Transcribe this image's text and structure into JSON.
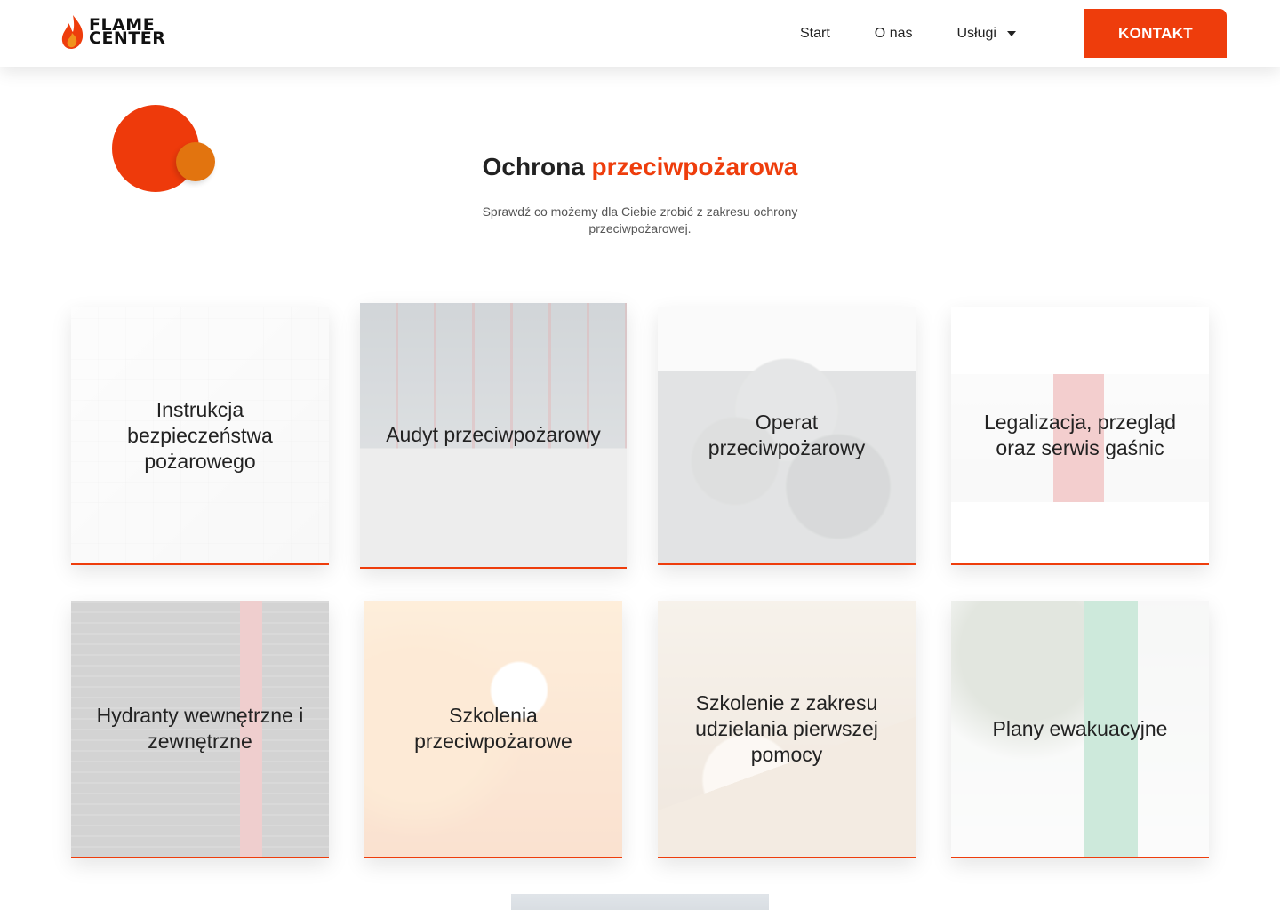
{
  "header": {
    "logo": {
      "line1": "FLAME",
      "line2": "CENTER",
      "flame_colors": [
        "#ee3d0c",
        "#f0921c"
      ]
    },
    "nav": [
      {
        "label": "Start"
      },
      {
        "label": "O nas"
      },
      {
        "label": "Usługi",
        "has_dropdown": true
      }
    ],
    "cta_label": "KONTAKT"
  },
  "hero": {
    "title_prefix": "Ochrona",
    "title_accent": "przeciwpożarowa",
    "subtitle": "Sprawdź co możemy dla Ciebie zrobić z zakresu ochrony przeciwpożarowej."
  },
  "services": [
    {
      "label": "Instrukcja bezpieczeństwa pożarowego",
      "image": "blueprint"
    },
    {
      "label": "Audyt przeciwpożarowy",
      "image": "warehouse"
    },
    {
      "label": "Operat przeciwpożarowy",
      "image": "scrapyard"
    },
    {
      "label": "Legalizacja, przegląd oraz serwis gaśnic",
      "image": "extinguisher"
    },
    {
      "label": "Hydranty wewnętrzne i zewnętrzne",
      "image": "hydrant"
    },
    {
      "label": "Szkolenia przeciwpożarowe",
      "image": "fire-training"
    },
    {
      "label": "Szkolenie z zakresu udzielania pierwszej pomocy",
      "image": "first-aid"
    },
    {
      "label": "Plany ewakuacyjne",
      "image": "evacuation-sign"
    }
  ],
  "colors": {
    "accent": "#ee3d0c",
    "accent_secondary": "#e2740f",
    "text": "#222222"
  }
}
